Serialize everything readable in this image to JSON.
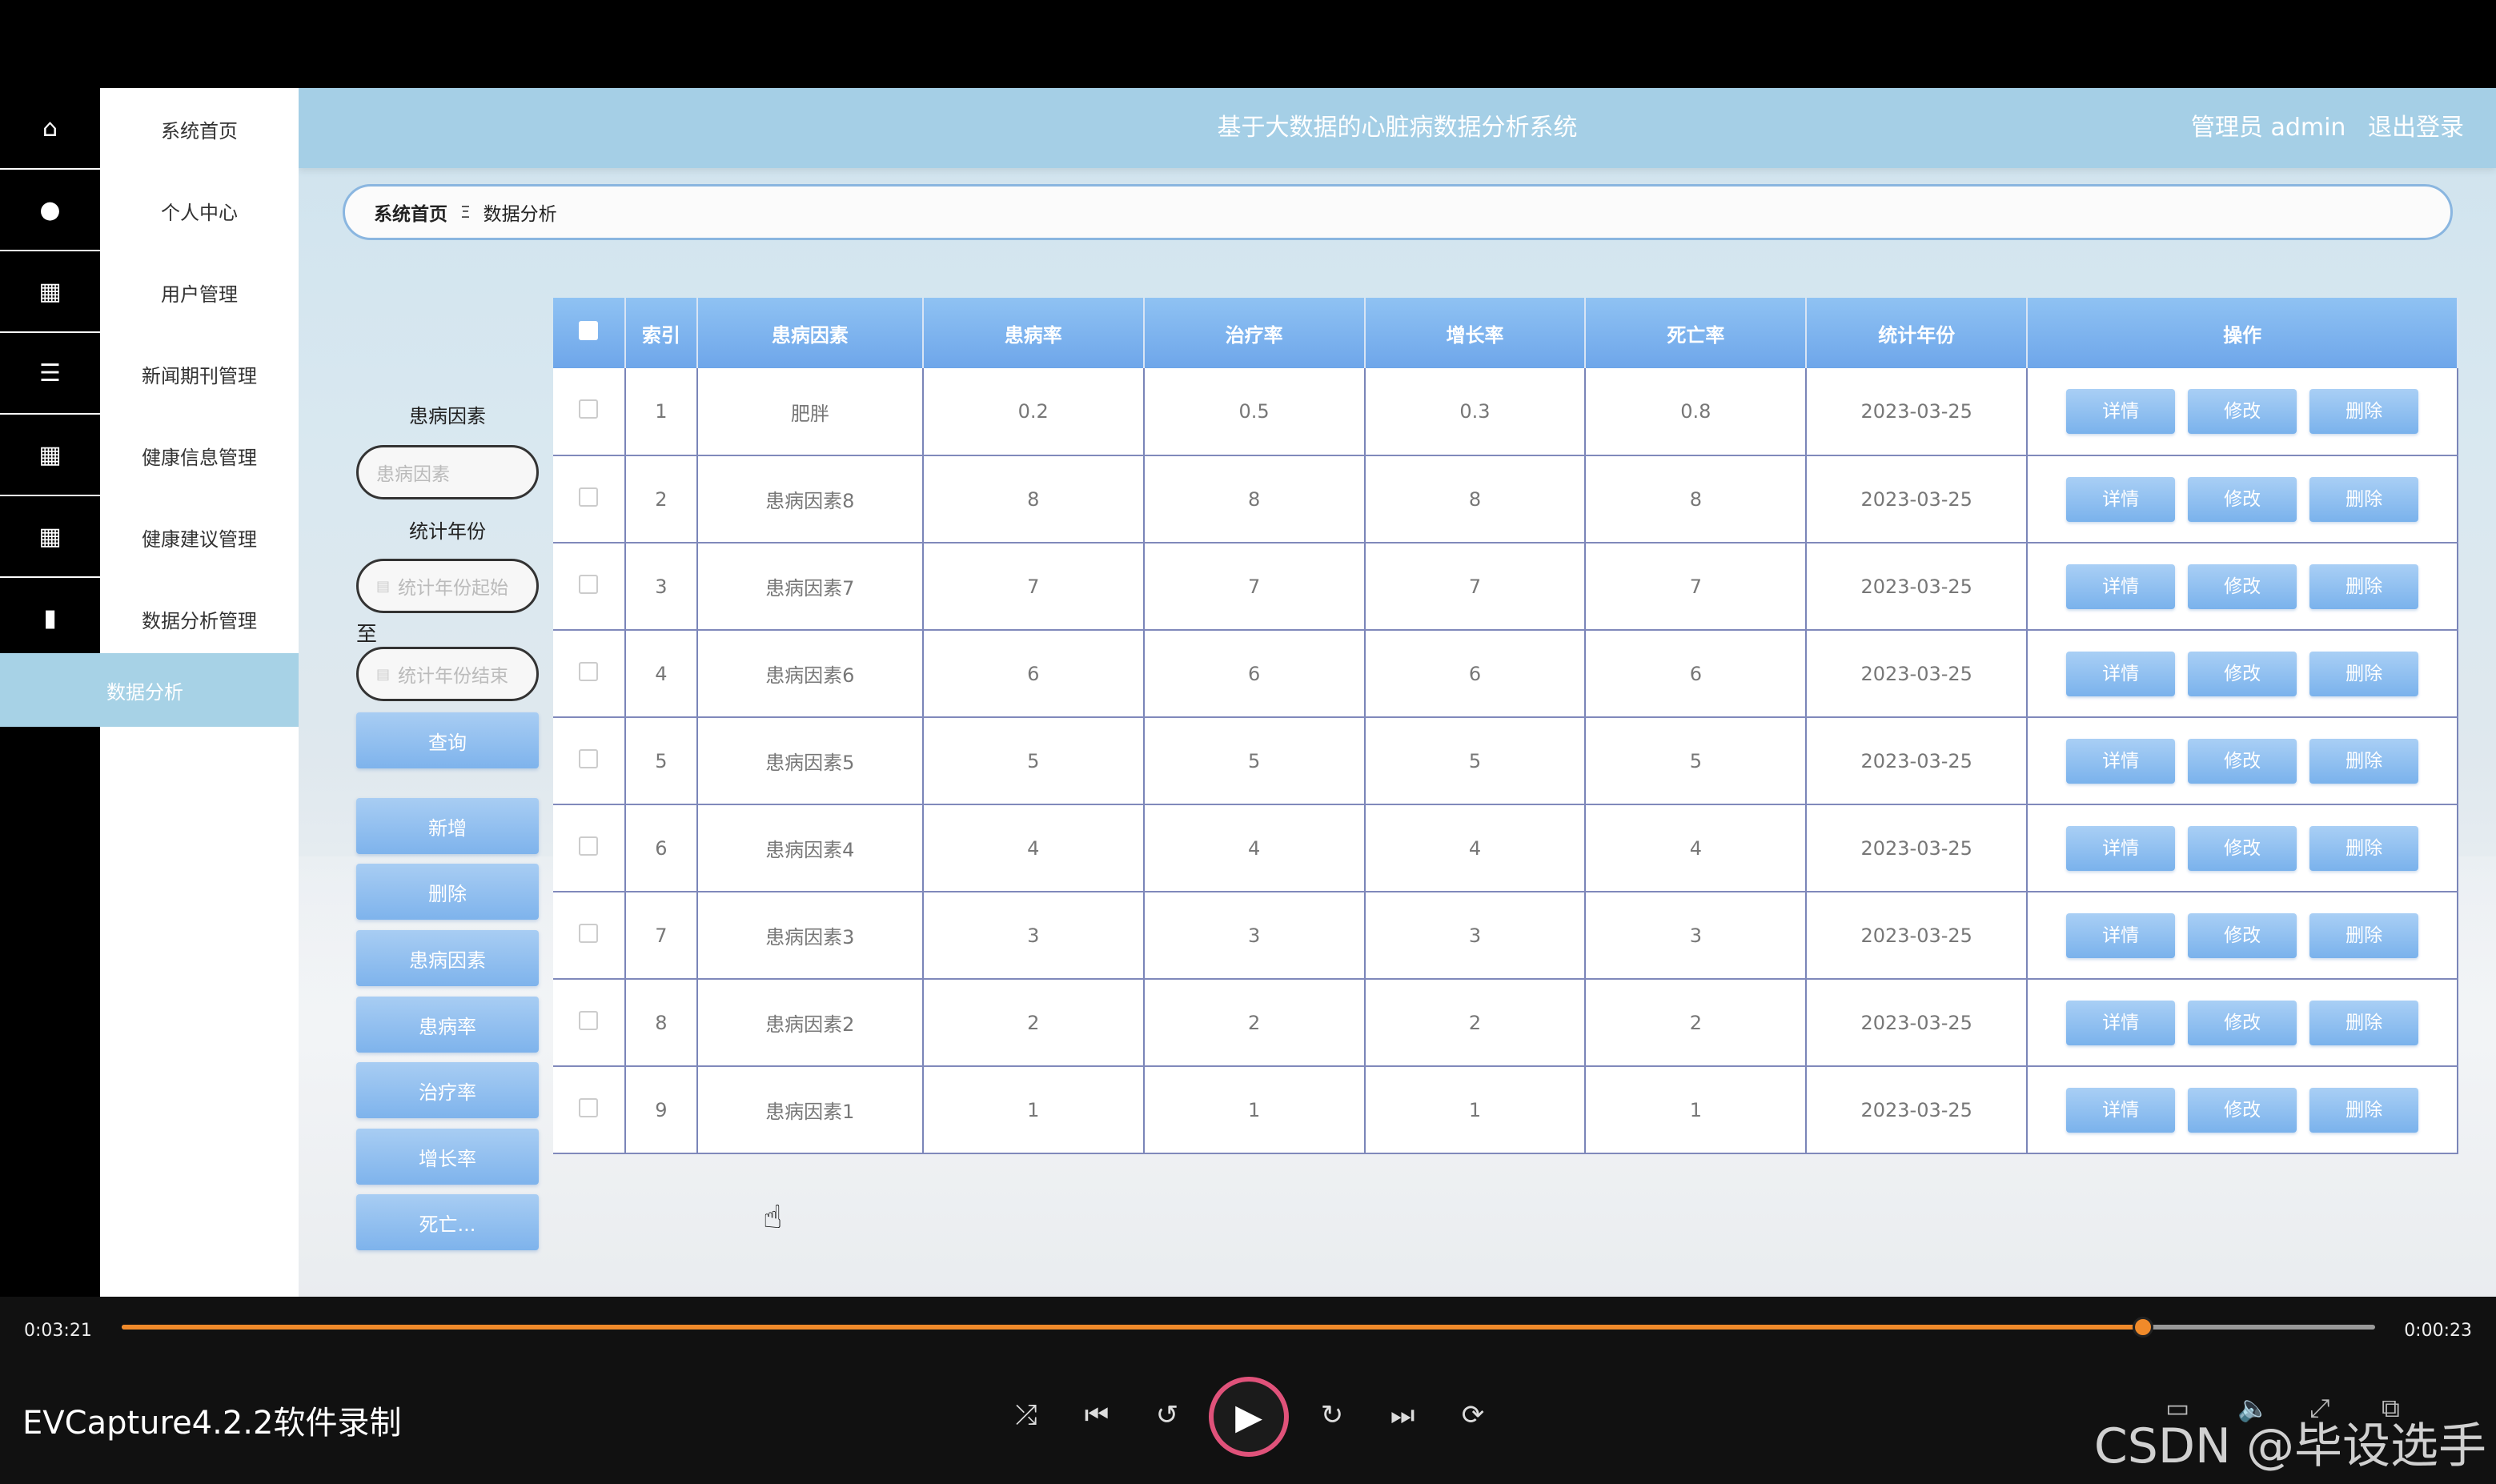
{
  "header": {
    "title": "基于大数据的心脏病数据分析系统",
    "user": "管理员 admin",
    "logout": "退出登录"
  },
  "sidebar": {
    "items": [
      {
        "label": "系统首页",
        "icon": "home-icon"
      },
      {
        "label": "个人中心",
        "icon": "user-icon"
      },
      {
        "label": "用户管理",
        "icon": "grid-icon"
      },
      {
        "label": "新闻期刊管理",
        "icon": "list-icon"
      },
      {
        "label": "健康信息管理",
        "icon": "grid-icon"
      },
      {
        "label": "健康建议管理",
        "icon": "grid-icon"
      },
      {
        "label": "数据分析管理",
        "icon": "book-icon"
      }
    ],
    "active_sub": "数据分析"
  },
  "breadcrumb": {
    "home": "系统首页",
    "sep": "Ξ",
    "current": "数据分析"
  },
  "filters": {
    "factor_label": "患病因素",
    "factor_placeholder": "患病因素",
    "year_label": "统计年份",
    "year_start_placeholder": "统计年份起始",
    "to": "至",
    "year_end_placeholder": "统计年份结束",
    "query": "查询"
  },
  "actions": [
    "新增",
    "删除",
    "患病因素",
    "患病率",
    "治疗率",
    "增长率",
    "死亡..."
  ],
  "table": {
    "headers": [
      "索引",
      "患病因素",
      "患病率",
      "治疗率",
      "增长率",
      "死亡率",
      "统计年份",
      "操作"
    ],
    "rows": [
      [
        "1",
        "肥胖",
        "0.2",
        "0.5",
        "0.3",
        "0.8",
        "2023-03-25"
      ],
      [
        "2",
        "患病因素8",
        "8",
        "8",
        "8",
        "8",
        "2023-03-25"
      ],
      [
        "3",
        "患病因素7",
        "7",
        "7",
        "7",
        "7",
        "2023-03-25"
      ],
      [
        "4",
        "患病因素6",
        "6",
        "6",
        "6",
        "6",
        "2023-03-25"
      ],
      [
        "5",
        "患病因素5",
        "5",
        "5",
        "5",
        "5",
        "2023-03-25"
      ],
      [
        "6",
        "患病因素4",
        "4",
        "4",
        "4",
        "4",
        "2023-03-25"
      ],
      [
        "7",
        "患病因素3",
        "3",
        "3",
        "3",
        "3",
        "2023-03-25"
      ],
      [
        "8",
        "患病因素2",
        "2",
        "2",
        "2",
        "2",
        "2023-03-25"
      ],
      [
        "9",
        "患病因素1",
        "1",
        "1",
        "1",
        "1",
        "2023-03-25"
      ]
    ],
    "row_buttons": [
      "详情",
      "修改",
      "删除"
    ]
  },
  "player": {
    "elapsed": "0:03:21",
    "remaining": "0:00:23",
    "progress": 0.897,
    "recorder": "EVCapture4.2.2软件录制",
    "watermark": "CSDN @毕设选手",
    "accent": "#f08a2a"
  }
}
